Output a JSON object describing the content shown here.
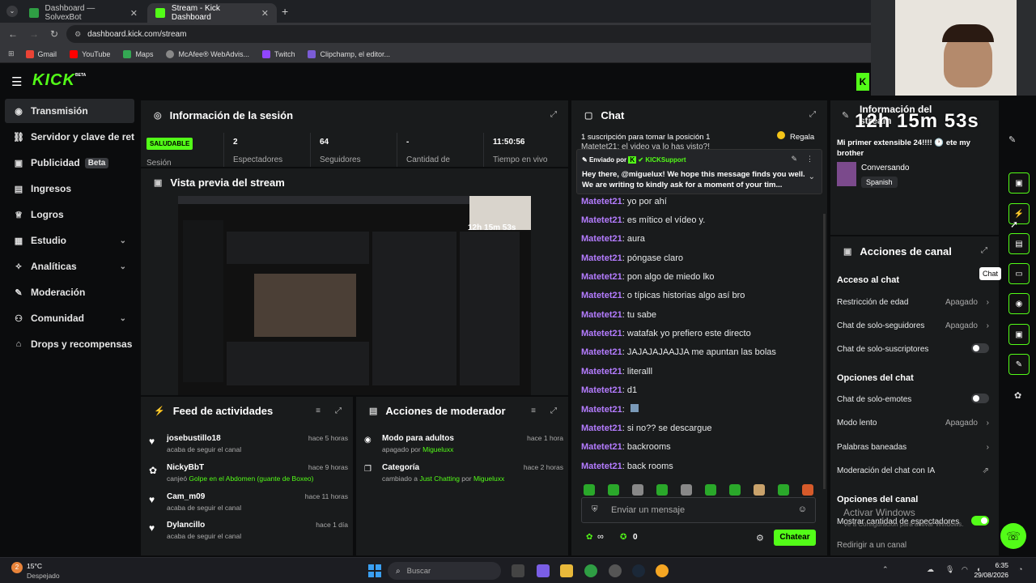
{
  "browser": {
    "tabs": [
      {
        "label": "Dashboard — SolvexBot"
      },
      {
        "label": "Stream - Kick Dashboard"
      }
    ],
    "url": "dashboard.kick.com/stream",
    "bookmarks": [
      "Gmail",
      "YouTube",
      "Maps",
      "McAfee® WebAdvis...",
      "Twitch",
      "Clipchamp, el editor..."
    ]
  },
  "app": {
    "logo": "KICK",
    "logo_badge": "BETA",
    "accent": "#53fc18"
  },
  "sidebar": {
    "items": [
      {
        "label": "Transmisión",
        "icon": "broadcast-icon"
      },
      {
        "label": "Servidor y clave de retransmisión",
        "icon": "link-icon"
      },
      {
        "label": "Publicidad",
        "badge": "Beta",
        "icon": "ad-icon"
      },
      {
        "label": "Ingresos",
        "icon": "revenue-icon"
      },
      {
        "label": "Logros",
        "icon": "trophy-icon"
      },
      {
        "label": "Estudio",
        "icon": "studio-icon"
      },
      {
        "label": "Analíticas",
        "icon": "analytics-icon"
      },
      {
        "label": "Moderación",
        "icon": "wrench-icon"
      },
      {
        "label": "Comunidad",
        "icon": "community-icon"
      },
      {
        "label": "Drops y recompensas",
        "icon": "gift-icon"
      }
    ]
  },
  "session": {
    "title": "Información de la sesión",
    "status_badge": "SALUDABLE",
    "status_label": "Sesión",
    "stats": [
      {
        "value": "2",
        "label": "Espectadores"
      },
      {
        "value": "64",
        "label": "Seguidores"
      },
      {
        "value": "-",
        "label": "Cantidad de"
      },
      {
        "value": "11:50:56",
        "label": "Tiempo en vivo"
      }
    ]
  },
  "preview": {
    "title": "Vista previa del stream"
  },
  "activity": {
    "title": "Feed de actividades",
    "items": [
      {
        "name": "josebustillo18",
        "desc": "acaba de seguir el canal",
        "time": "hace 5 horas",
        "icon": "heart-icon"
      },
      {
        "name": "NickyBbT",
        "desc_pre": "canjeó ",
        "desc_hl": "Golpe en el Abdomen (guante de Boxeo)",
        "time": "hace 9 horas",
        "icon": "reward-icon"
      },
      {
        "name": "Cam_m09",
        "desc": "acaba de seguir el canal",
        "time": "hace 11 horas",
        "icon": "heart-icon"
      },
      {
        "name": "Dylancillo",
        "desc": "acaba de seguir el canal",
        "time": "hace 1 día",
        "icon": "heart-icon"
      }
    ]
  },
  "mod_actions": {
    "title": "Acciones de moderador",
    "items": [
      {
        "name": "Modo para adultos",
        "pre": "apagado por ",
        "by": "Migueluxx",
        "time": "hace 1 hora"
      },
      {
        "name": "Categoría",
        "pre": "cambiado a ",
        "hl": "Just Chatting",
        "mid": " por ",
        "by": "Migueluxx",
        "time": "hace 2 horas"
      }
    ]
  },
  "chat": {
    "title": "Chat",
    "sub_text": "1 suscripción para tomar la posición 1",
    "gift_label": "Regala",
    "partial_line": "Matetet21: el video va lo has visto?!",
    "pinned": {
      "sent_by": "Enviado por",
      "sender": "KICKSupport",
      "text": "Hey there, @miguelux! We hope this message finds you well. We are writing to kindly ask for a moment of your tim..."
    },
    "messages": [
      {
        "user": "Matetet21",
        "text": "yo por ahí"
      },
      {
        "user": "Matetet21",
        "text": "es mítico el vídeo y."
      },
      {
        "user": "Matetet21",
        "text": "aura"
      },
      {
        "user": "Matetet21",
        "text": "póngase claro"
      },
      {
        "user": "Matetet21",
        "text": "pon algo de miedo lko"
      },
      {
        "user": "Matetet21",
        "text": "o típicas historias algo así bro"
      },
      {
        "user": "Matetet21",
        "text": "tu sabe"
      },
      {
        "user": "Matetet21",
        "text": "watafak yo prefiero este directo"
      },
      {
        "user": "Matetet21",
        "text": "JAJAJAJAAJJA me apuntan las bolas"
      },
      {
        "user": "Matetet21",
        "text": "literalll"
      },
      {
        "user": "Matetet21",
        "text": "d1"
      },
      {
        "user": "Matetet21",
        "text": ""
      },
      {
        "user": "Matetet21",
        "text": "si no?? se descargue"
      },
      {
        "user": "Matetet21",
        "text": "backrooms"
      },
      {
        "user": "Matetet21",
        "text": "back rooms"
      }
    ],
    "input_placeholder": "Enviar un mensaje",
    "infinity": "∞",
    "kicks": "0",
    "send_label": "Chatear"
  },
  "stream_info": {
    "title": "Información del stream",
    "stream_title": "Mi primer extensible 24!!!! 🕐 ete my brother",
    "category": "Conversando",
    "language": "Spanish"
  },
  "overlay_timer": "12h 15m 53s",
  "channel_actions": {
    "title": "Acciones de canal",
    "access_title": "Acceso al chat",
    "access_rows": [
      {
        "label": "Restricción de edad",
        "value": "Apagado"
      },
      {
        "label": "Chat de solo-seguidores",
        "value": "Apagado"
      },
      {
        "label": "Chat de solo-suscriptores",
        "toggle": false
      }
    ],
    "chat_title": "Opciones del chat",
    "chat_rows": [
      {
        "label": "Chat de solo-emotes",
        "toggle": false
      },
      {
        "label": "Modo lento",
        "value": "Apagado"
      },
      {
        "label": "Palabras baneadas"
      },
      {
        "label": "Moderación del chat con IA"
      }
    ],
    "channel_title": "Opciones del canal",
    "channel_rows": [
      {
        "label": "Mostrar cantidad de espectadores",
        "toggle": true
      },
      {
        "label": "Redirigir a un canal"
      }
    ]
  },
  "tooltip_chat": "Chat",
  "watermark": {
    "line1": "Activar Windows",
    "line2": "Ve a Configuración para activar Windows."
  },
  "taskbar": {
    "temp": "15°C",
    "weather": "Despejado",
    "search": "Buscar",
    "time": "6:35",
    "date": "29/08/2026",
    "notif": "2"
  }
}
